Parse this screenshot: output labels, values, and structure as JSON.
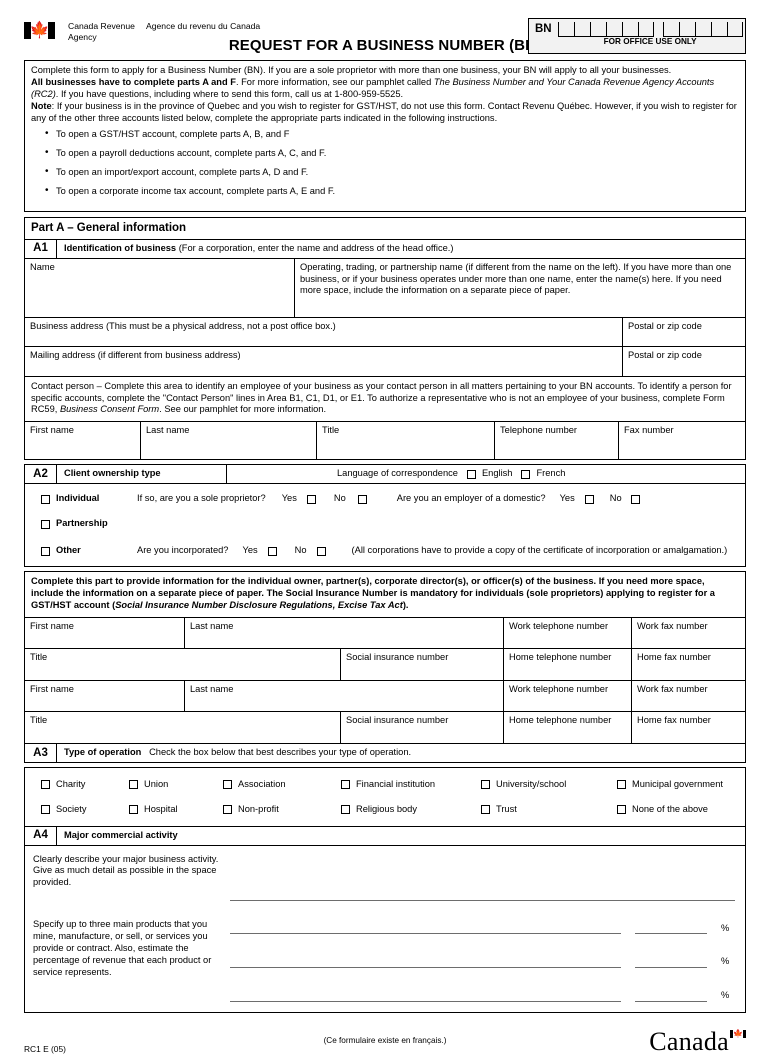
{
  "header": {
    "agency_en": "Canada Revenue Agency",
    "agency_fr": "Agence du revenu du Canada",
    "form_title": "REQUEST FOR A BUSINESS NUMBER (BN)",
    "bn_label": "BN",
    "office_use": "FOR OFFICE USE ONLY"
  },
  "intro": {
    "line1": "Complete this form to apply for a Business Number (BN). If you are a sole proprietor with more than one business, your BN will apply to all your businesses.",
    "line2_bold": "All businesses have to complete parts A and F",
    "line2_rest": ". For more information, see our pamphlet called ",
    "line2_italic": "The Business Number and Your Canada Revenue Agency Accounts (RC2)",
    "line2_tail": ". If you have questions, including where to send this form, call us at 1-800-959-5525.",
    "note_label": "Note",
    "note_text": ": If your business is in the province of Quebec and you wish to register for GST/HST, do not use this form. Contact Revenu Québec. However, if you wish to register for any of the other three accounts listed below, complete the appropriate parts indicated in the following instructions.",
    "bullets": [
      "To open a GST/HST account, complete parts A, B, and F",
      "To open a payroll deductions account, complete parts A, C, and F.",
      "To open an import/export account, complete parts A, D and F.",
      "To open a corporate income tax account, complete parts A, E and F."
    ]
  },
  "partA": {
    "heading": "Part A – General information",
    "a1": {
      "code": "A1",
      "title": "Identification of business",
      "subtitle": "(For a corporation, enter the name and address of the head office.)",
      "name_label": "Name",
      "operating_label": "Operating, trading, or partnership name (if different from the name on the left). If you have more than one business, or if your business operates under more than one name, enter the name(s) here. If you need more space, include the information on a separate piece of paper.",
      "business_address_label": "Business address (This must be a physical address, not a post office box.)",
      "postal_label_1": "Postal or zip code",
      "mailing_address_label": "Mailing address (if different from business address)",
      "postal_label_2": "Postal or zip code",
      "contact_person_text": "Contact person – Complete this area to identify an employee of your business as your contact person in all matters pertaining to your BN accounts. To identify a person for specific accounts, complete the \"Contact Person\" lines in Area B1, C1, D1, or E1. To authorize a representative who is not an employee of your business, complete Form RC59, ",
      "contact_person_italic": "Business Consent Form",
      "contact_person_tail": ". See our pamphlet for more information.",
      "contact_fields": [
        "First name",
        "Last name",
        "Title",
        "Telephone number",
        "Fax number"
      ]
    },
    "a2": {
      "code": "A2",
      "title": "Client ownership type",
      "language_label": "Language of correspondence",
      "language_options": [
        "English",
        "French"
      ],
      "individual_label": "Individual",
      "sole_prop_question": "If so, are you a sole proprietor?",
      "yes_label": "Yes",
      "no_label": "No",
      "domestic_question": "Are you an employer of a domestic?",
      "partnership_label": "Partnership",
      "other_label": "Other",
      "incorporated_question": "Are you incorporated?",
      "incorporated_note": "(All corporations have to provide a copy of the certificate of incorporation or amalgamation.)",
      "owner_instructions_1": "Complete this part to provide information for the individual owner, partner(s), corporate director(s), or officer(s) of the business. If you need more space, include the information on a separate piece of paper. The Social Insurance Number is mandatory for individuals (sole proprietors) applying to register for a GST/HST account (",
      "owner_instructions_italic": "Social Insurance Number Disclosure Regulations, Excise Tax Act",
      "owner_instructions_tail": ").",
      "owner_rows": [
        {
          "first_name": "First name",
          "last_name": "Last name",
          "work_tel": "Work telephone number",
          "work_fax": "Work fax number"
        },
        {
          "title": "Title",
          "sin": "Social insurance number",
          "home_tel": "Home telephone number",
          "home_fax": "Home fax number"
        },
        {
          "first_name": "First name",
          "last_name": "Last name",
          "work_tel": "Work telephone number",
          "work_fax": "Work fax number"
        },
        {
          "title": "Title",
          "sin": "Social insurance number",
          "home_tel": "Home telephone number",
          "home_fax": "Home fax number"
        }
      ]
    },
    "a3": {
      "code": "A3",
      "title": "Type of operation",
      "subtitle": "Check the box below that best describes your type of operation.",
      "row1": [
        "Charity",
        "Union",
        "Association",
        "Financial institution",
        "University/school",
        "Municipal government"
      ],
      "row2": [
        "Society",
        "Hospital",
        "Non-profit",
        "Religious body",
        "Trust",
        "None of the above"
      ]
    },
    "a4": {
      "code": "A4",
      "title": "Major commercial activity",
      "describe_text": "Clearly describe your major business activity. Give as much detail as possible in the space provided.",
      "products_text": "Specify up to three main products that you mine, manufacture, or sell, or services you provide or contract. Also, estimate the percentage of revenue that each product or service represents.",
      "percent_symbol": "%",
      "product_line_count": 3
    }
  },
  "footer": {
    "form_code": "RC1 E (05)",
    "french_note": "(Ce formulaire existe en français.)",
    "wordmark": "Canada"
  }
}
